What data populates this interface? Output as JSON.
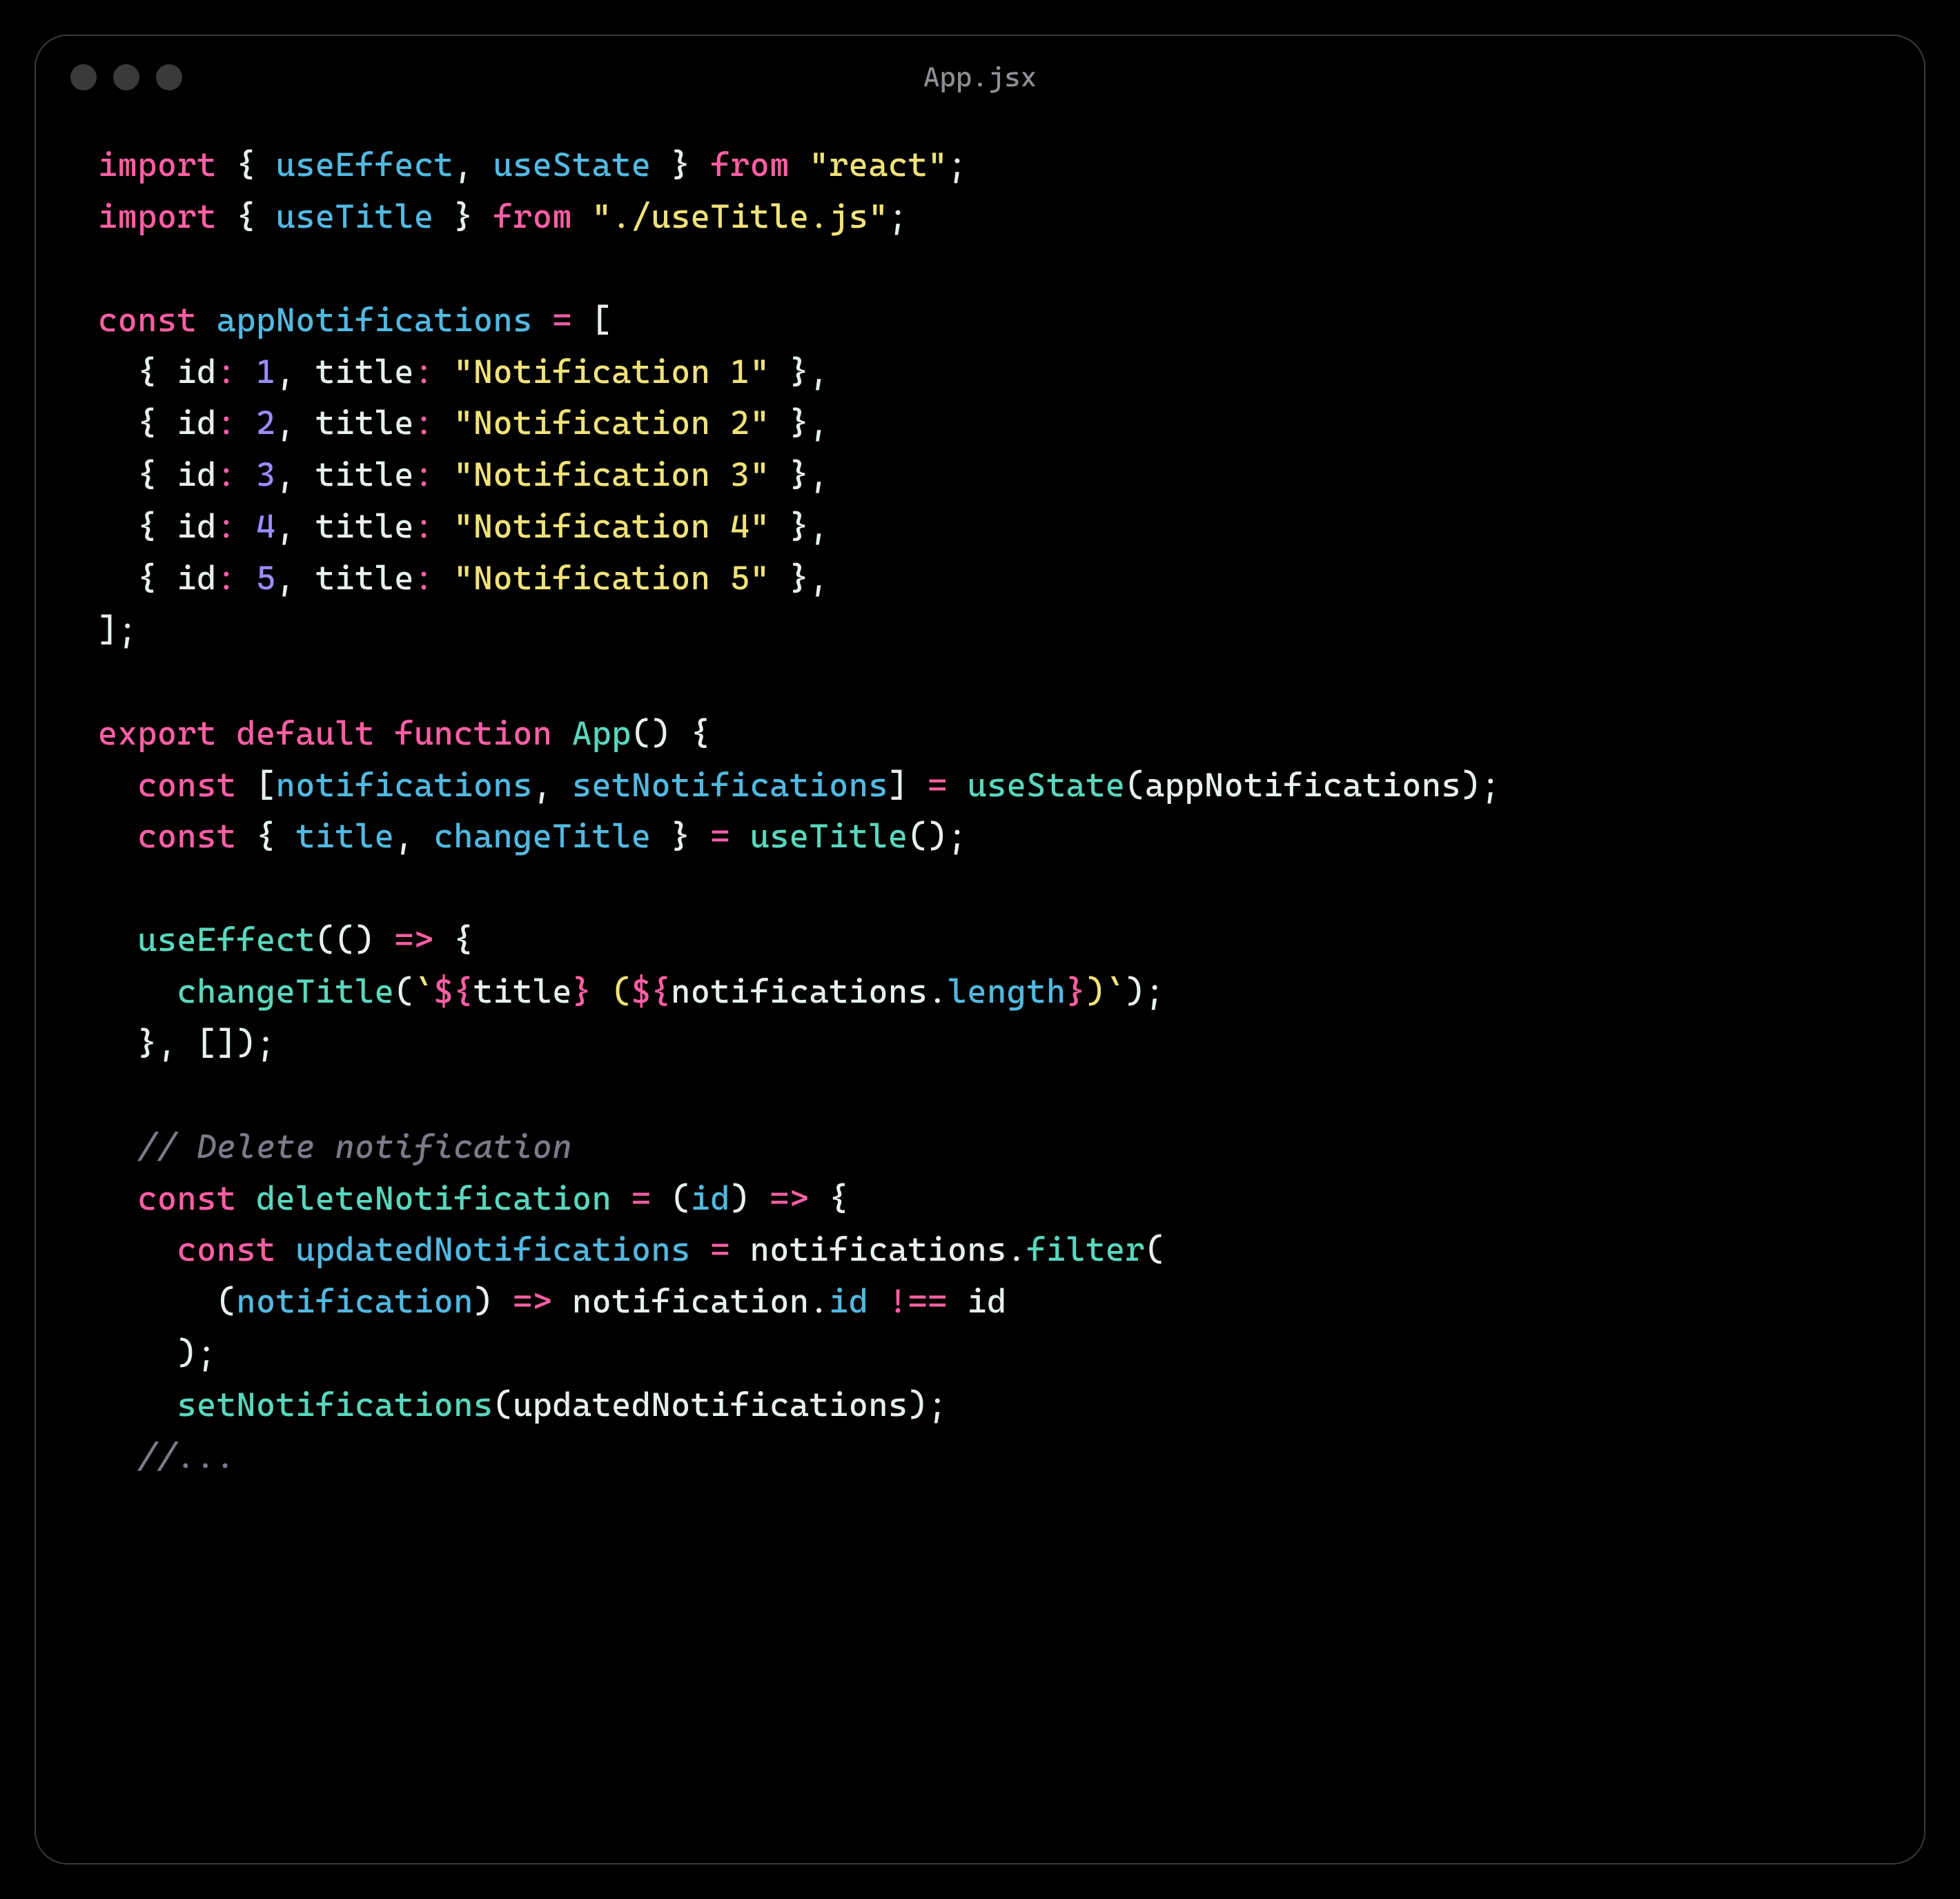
{
  "window": {
    "filename": "App.jsx"
  },
  "code": {
    "lines": [
      [
        {
          "t": "import",
          "c": "tk-kw"
        },
        {
          "t": " ",
          "c": "tk-punc"
        },
        {
          "t": "{ ",
          "c": "tk-punc"
        },
        {
          "t": "useEffect",
          "c": "tk-var"
        },
        {
          "t": ", ",
          "c": "tk-punc"
        },
        {
          "t": "useState",
          "c": "tk-var"
        },
        {
          "t": " } ",
          "c": "tk-punc"
        },
        {
          "t": "from",
          "c": "tk-kw"
        },
        {
          "t": " ",
          "c": "tk-punc"
        },
        {
          "t": "\"react\"",
          "c": "tk-str"
        },
        {
          "t": ";",
          "c": "tk-punc"
        }
      ],
      [
        {
          "t": "import",
          "c": "tk-kw"
        },
        {
          "t": " ",
          "c": "tk-punc"
        },
        {
          "t": "{ ",
          "c": "tk-punc"
        },
        {
          "t": "useTitle",
          "c": "tk-var"
        },
        {
          "t": " } ",
          "c": "tk-punc"
        },
        {
          "t": "from",
          "c": "tk-kw"
        },
        {
          "t": " ",
          "c": "tk-punc"
        },
        {
          "t": "\"./useTitle.js\"",
          "c": "tk-str"
        },
        {
          "t": ";",
          "c": "tk-punc"
        }
      ],
      [],
      [
        {
          "t": "const",
          "c": "tk-kw"
        },
        {
          "t": " ",
          "c": "tk-punc"
        },
        {
          "t": "appNotifications",
          "c": "tk-var"
        },
        {
          "t": " ",
          "c": "tk-punc"
        },
        {
          "t": "=",
          "c": "tk-op"
        },
        {
          "t": " [",
          "c": "tk-punc"
        }
      ],
      [
        {
          "t": "  { ",
          "c": "tk-punc"
        },
        {
          "t": "id",
          "c": "tk-prop"
        },
        {
          "t": ":",
          "c": "tk-op"
        },
        {
          "t": " ",
          "c": "tk-punc"
        },
        {
          "t": "1",
          "c": "tk-num"
        },
        {
          "t": ", ",
          "c": "tk-punc"
        },
        {
          "t": "title",
          "c": "tk-prop"
        },
        {
          "t": ":",
          "c": "tk-op"
        },
        {
          "t": " ",
          "c": "tk-punc"
        },
        {
          "t": "\"Notification 1\"",
          "c": "tk-str"
        },
        {
          "t": " },",
          "c": "tk-punc"
        }
      ],
      [
        {
          "t": "  { ",
          "c": "tk-punc"
        },
        {
          "t": "id",
          "c": "tk-prop"
        },
        {
          "t": ":",
          "c": "tk-op"
        },
        {
          "t": " ",
          "c": "tk-punc"
        },
        {
          "t": "2",
          "c": "tk-num"
        },
        {
          "t": ", ",
          "c": "tk-punc"
        },
        {
          "t": "title",
          "c": "tk-prop"
        },
        {
          "t": ":",
          "c": "tk-op"
        },
        {
          "t": " ",
          "c": "tk-punc"
        },
        {
          "t": "\"Notification 2\"",
          "c": "tk-str"
        },
        {
          "t": " },",
          "c": "tk-punc"
        }
      ],
      [
        {
          "t": "  { ",
          "c": "tk-punc"
        },
        {
          "t": "id",
          "c": "tk-prop"
        },
        {
          "t": ":",
          "c": "tk-op"
        },
        {
          "t": " ",
          "c": "tk-punc"
        },
        {
          "t": "3",
          "c": "tk-num"
        },
        {
          "t": ", ",
          "c": "tk-punc"
        },
        {
          "t": "title",
          "c": "tk-prop"
        },
        {
          "t": ":",
          "c": "tk-op"
        },
        {
          "t": " ",
          "c": "tk-punc"
        },
        {
          "t": "\"Notification 3\"",
          "c": "tk-str"
        },
        {
          "t": " },",
          "c": "tk-punc"
        }
      ],
      [
        {
          "t": "  { ",
          "c": "tk-punc"
        },
        {
          "t": "id",
          "c": "tk-prop"
        },
        {
          "t": ":",
          "c": "tk-op"
        },
        {
          "t": " ",
          "c": "tk-punc"
        },
        {
          "t": "4",
          "c": "tk-num"
        },
        {
          "t": ", ",
          "c": "tk-punc"
        },
        {
          "t": "title",
          "c": "tk-prop"
        },
        {
          "t": ":",
          "c": "tk-op"
        },
        {
          "t": " ",
          "c": "tk-punc"
        },
        {
          "t": "\"Notification 4\"",
          "c": "tk-str"
        },
        {
          "t": " },",
          "c": "tk-punc"
        }
      ],
      [
        {
          "t": "  { ",
          "c": "tk-punc"
        },
        {
          "t": "id",
          "c": "tk-prop"
        },
        {
          "t": ":",
          "c": "tk-op"
        },
        {
          "t": " ",
          "c": "tk-punc"
        },
        {
          "t": "5",
          "c": "tk-num"
        },
        {
          "t": ", ",
          "c": "tk-punc"
        },
        {
          "t": "title",
          "c": "tk-prop"
        },
        {
          "t": ":",
          "c": "tk-op"
        },
        {
          "t": " ",
          "c": "tk-punc"
        },
        {
          "t": "\"Notification 5\"",
          "c": "tk-str"
        },
        {
          "t": " },",
          "c": "tk-punc"
        }
      ],
      [
        {
          "t": "];",
          "c": "tk-punc"
        }
      ],
      [],
      [
        {
          "t": "export",
          "c": "tk-kw"
        },
        {
          "t": " ",
          "c": "tk-punc"
        },
        {
          "t": "default",
          "c": "tk-kw"
        },
        {
          "t": " ",
          "c": "tk-punc"
        },
        {
          "t": "function",
          "c": "tk-kw"
        },
        {
          "t": " ",
          "c": "tk-punc"
        },
        {
          "t": "App",
          "c": "tk-fn"
        },
        {
          "t": "() {",
          "c": "tk-punc"
        }
      ],
      [
        {
          "t": "  ",
          "c": "tk-punc"
        },
        {
          "t": "const",
          "c": "tk-kw"
        },
        {
          "t": " [",
          "c": "tk-punc"
        },
        {
          "t": "notifications",
          "c": "tk-var"
        },
        {
          "t": ", ",
          "c": "tk-punc"
        },
        {
          "t": "setNotifications",
          "c": "tk-var"
        },
        {
          "t": "] ",
          "c": "tk-punc"
        },
        {
          "t": "=",
          "c": "tk-op"
        },
        {
          "t": " ",
          "c": "tk-punc"
        },
        {
          "t": "useState",
          "c": "tk-fn"
        },
        {
          "t": "(appNotifications);",
          "c": "tk-punc"
        }
      ],
      [
        {
          "t": "  ",
          "c": "tk-punc"
        },
        {
          "t": "const",
          "c": "tk-kw"
        },
        {
          "t": " { ",
          "c": "tk-punc"
        },
        {
          "t": "title",
          "c": "tk-var"
        },
        {
          "t": ", ",
          "c": "tk-punc"
        },
        {
          "t": "changeTitle",
          "c": "tk-var"
        },
        {
          "t": " } ",
          "c": "tk-punc"
        },
        {
          "t": "=",
          "c": "tk-op"
        },
        {
          "t": " ",
          "c": "tk-punc"
        },
        {
          "t": "useTitle",
          "c": "tk-fn"
        },
        {
          "t": "();",
          "c": "tk-punc"
        }
      ],
      [],
      [
        {
          "t": "  ",
          "c": "tk-punc"
        },
        {
          "t": "useEffect",
          "c": "tk-fn"
        },
        {
          "t": "(() ",
          "c": "tk-punc"
        },
        {
          "t": "=>",
          "c": "tk-op"
        },
        {
          "t": " {",
          "c": "tk-punc"
        }
      ],
      [
        {
          "t": "    ",
          "c": "tk-punc"
        },
        {
          "t": "changeTitle",
          "c": "tk-fn"
        },
        {
          "t": "(",
          "c": "tk-punc"
        },
        {
          "t": "`",
          "c": "tk-str"
        },
        {
          "t": "${",
          "c": "tk-op"
        },
        {
          "t": "title",
          "c": "tk-prop"
        },
        {
          "t": "}",
          "c": "tk-op"
        },
        {
          "t": " (",
          "c": "tk-str"
        },
        {
          "t": "${",
          "c": "tk-op"
        },
        {
          "t": "notifications.",
          "c": "tk-prop"
        },
        {
          "t": "length",
          "c": "tk-var"
        },
        {
          "t": "}",
          "c": "tk-op"
        },
        {
          "t": ")",
          "c": "tk-str"
        },
        {
          "t": "`",
          "c": "tk-str"
        },
        {
          "t": ");",
          "c": "tk-punc"
        }
      ],
      [
        {
          "t": "  }, []);",
          "c": "tk-punc"
        }
      ],
      [],
      [
        {
          "t": "  ",
          "c": "tk-punc"
        },
        {
          "t": "// Delete notification",
          "c": "tk-cmt"
        }
      ],
      [
        {
          "t": "  ",
          "c": "tk-punc"
        },
        {
          "t": "const",
          "c": "tk-kw"
        },
        {
          "t": " ",
          "c": "tk-punc"
        },
        {
          "t": "deleteNotification",
          "c": "tk-fn"
        },
        {
          "t": " ",
          "c": "tk-punc"
        },
        {
          "t": "=",
          "c": "tk-op"
        },
        {
          "t": " (",
          "c": "tk-punc"
        },
        {
          "t": "id",
          "c": "tk-var"
        },
        {
          "t": ") ",
          "c": "tk-punc"
        },
        {
          "t": "=>",
          "c": "tk-op"
        },
        {
          "t": " {",
          "c": "tk-punc"
        }
      ],
      [
        {
          "t": "    ",
          "c": "tk-punc"
        },
        {
          "t": "const",
          "c": "tk-kw"
        },
        {
          "t": " ",
          "c": "tk-punc"
        },
        {
          "t": "updatedNotifications",
          "c": "tk-var"
        },
        {
          "t": " ",
          "c": "tk-punc"
        },
        {
          "t": "=",
          "c": "tk-op"
        },
        {
          "t": " notifications.",
          "c": "tk-punc"
        },
        {
          "t": "filter",
          "c": "tk-fn"
        },
        {
          "t": "(",
          "c": "tk-punc"
        }
      ],
      [
        {
          "t": "      (",
          "c": "tk-punc"
        },
        {
          "t": "notification",
          "c": "tk-var"
        },
        {
          "t": ") ",
          "c": "tk-punc"
        },
        {
          "t": "=>",
          "c": "tk-op"
        },
        {
          "t": " notification.",
          "c": "tk-punc"
        },
        {
          "t": "id",
          "c": "tk-var"
        },
        {
          "t": " ",
          "c": "tk-punc"
        },
        {
          "t": "!==",
          "c": "tk-op"
        },
        {
          "t": " id",
          "c": "tk-punc"
        }
      ],
      [
        {
          "t": "    );",
          "c": "tk-punc"
        }
      ],
      [
        {
          "t": "    ",
          "c": "tk-punc"
        },
        {
          "t": "setNotifications",
          "c": "tk-fn"
        },
        {
          "t": "(updatedNotifications);",
          "c": "tk-punc"
        }
      ],
      [
        {
          "t": "  ",
          "c": "tk-punc"
        },
        {
          "t": "//...",
          "c": "tk-cmt"
        }
      ]
    ]
  }
}
